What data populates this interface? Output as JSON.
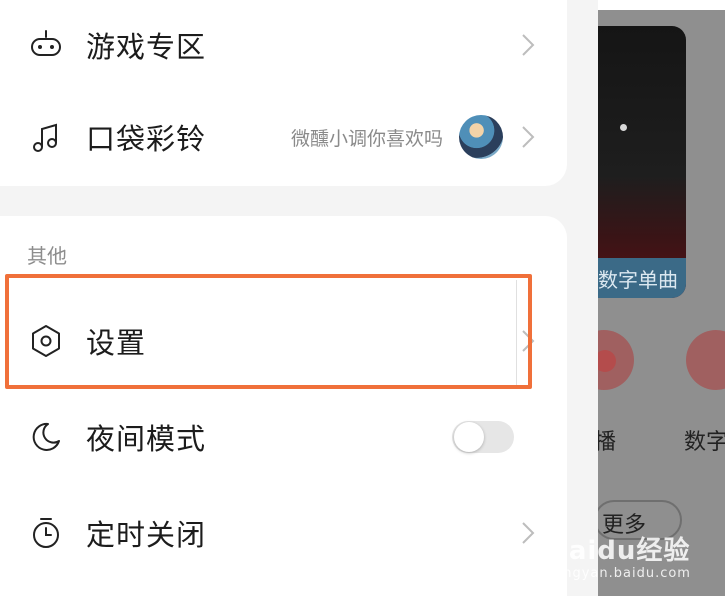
{
  "menu": {
    "items_top": [
      {
        "label": "游戏专区",
        "icon": "gamepad-icon"
      },
      {
        "label": "口袋彩铃",
        "icon": "music-note-icon",
        "extra": "微醺小调你喜欢吗"
      }
    ],
    "section_title": "其他",
    "items_other": [
      {
        "label": "设置",
        "icon": "settings-hexagon-icon"
      },
      {
        "label": "夜间模式",
        "icon": "moon-icon",
        "toggle": false
      },
      {
        "label": "定时关闭",
        "icon": "timer-icon"
      }
    ]
  },
  "background": {
    "media_caption": "数字单曲",
    "tab_left": "播",
    "tab_right": "数字",
    "more_label": "更多"
  },
  "watermark": {
    "brand": "Baidu经验",
    "url": "jingyan.baidu.com"
  },
  "colors": {
    "highlight": "#f0703a",
    "drawer_bg": "#f4f4f4",
    "card_bg": "#ffffff"
  }
}
